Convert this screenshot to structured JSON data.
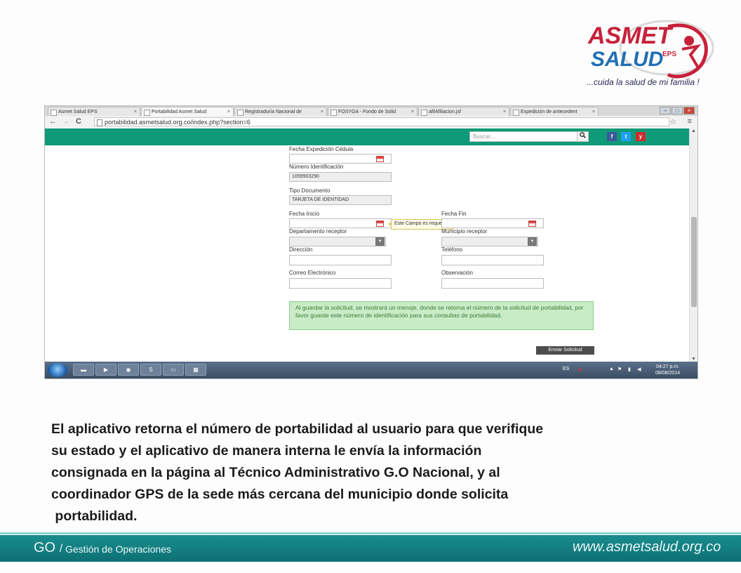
{
  "slide": {
    "tagline": "...cuida la salud de mi familia !",
    "logo": {
      "top": "ASMET",
      "bottom": "SALUD",
      "suffix": "EPS"
    },
    "body_lines": [
      "El aplicativo retorna el número de portabilidad al usuario para que verifique",
      "su estado y el aplicativo de manera interna le envía la información",
      "consignada en la página al Técnico Administrativo G.O Nacional, y al",
      "coordinador GPS de la sede más cercana del municipio donde solicita",
      " portabilidad."
    ],
    "footer": {
      "go": "GO",
      "sep": "/",
      "subtitle": "Gestión de Operaciones",
      "url": "www.asmetsalud.org.co"
    }
  },
  "browser": {
    "tabs": [
      {
        "label": "Asmet Salud EPS"
      },
      {
        "label": "Portabilidad Asmet Salud"
      },
      {
        "label": "Registraduría Nacional de"
      },
      {
        "label": "FOSYGA - Fondo de Solid"
      },
      {
        "label": "afilAfiliacion.jsf"
      },
      {
        "label": "Expedición de antecedent"
      }
    ],
    "tab_close": "×",
    "url": "portabilidad.asmetsalud.org.co/index.php?section=6",
    "back": "←",
    "forward": "→",
    "reload": "C",
    "star": "☆",
    "menu": "≡"
  },
  "site": {
    "search_placeholder": "Buscar...",
    "search_icon": "search-icon",
    "social": [
      "f",
      "t",
      "y"
    ],
    "colors": {
      "header": "#0f9a78",
      "notice_bg": "#c9ecc7",
      "facebook": "#3b5998",
      "twitter": "#1da1f2",
      "youtube": "#cc2d2d"
    }
  },
  "form": {
    "fecha_expedicion": {
      "label": "Fecha Expedición Cédula",
      "value": ""
    },
    "numero_identificacion": {
      "label": "Número Identificación",
      "value": "1059903290"
    },
    "tipo_documento": {
      "label": "Tipo Documento",
      "value": "TARJETA DE IDENTIDAD"
    },
    "fecha_inicio": {
      "label": "Fecha Inicio",
      "value": ""
    },
    "fecha_fin": {
      "label": "Fecha Fin",
      "value": ""
    },
    "tooltip": "Este Campo es requerido",
    "departamento": {
      "label": "Departamento receptor",
      "value": ""
    },
    "municipio": {
      "label": "Municipio receptor",
      "value": ""
    },
    "direccion": {
      "label": "Dirección",
      "value": ""
    },
    "telefono": {
      "label": "Teléfono",
      "value": ""
    },
    "correo": {
      "label": "Correo Electrónico",
      "value": ""
    },
    "observacion": {
      "label": "Observación",
      "value": ""
    },
    "notice": "Al guardar la solicitud, se mostrará un mensje, donde se retorna el número de la solicitud de portabilidad, por favor guarde este número de identificación para sus consultas de portabilidad.",
    "submit_label": "Enviar Solicitud"
  },
  "taskbar": {
    "lang": "ES",
    "time": "04:27 p.m.",
    "date": "08/08/2014"
  }
}
